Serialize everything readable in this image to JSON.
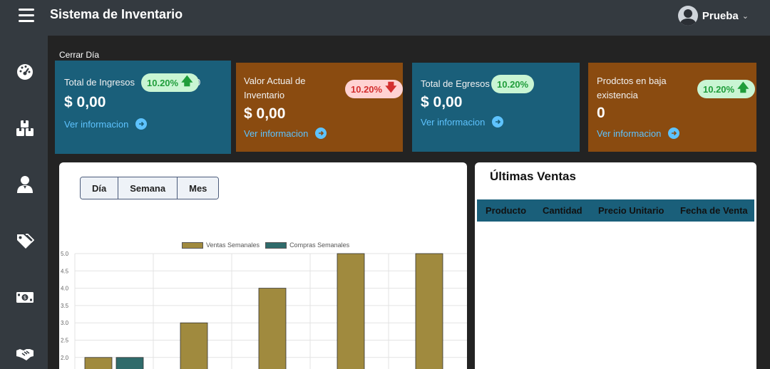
{
  "header": {
    "title": "Sistema de Inventario",
    "user_name": "Prueba",
    "user_chevron": "⌵"
  },
  "main": {
    "cerrar_label": "Cerrar Día"
  },
  "cards": [
    {
      "title": "Total de Ingresos",
      "title_suffix": "0",
      "value": "$ 0,00",
      "link": "Ver informacion",
      "badge": "10.20%",
      "trend": "up",
      "color": "#1a5f7a"
    },
    {
      "title": "Valor Actual de Inventario",
      "value": "$ 0,00",
      "link": "Ver informacion",
      "badge": "10.20%",
      "trend": "down",
      "color": "#8a4b10"
    },
    {
      "title": "Total de Egresos",
      "value": "$ 0,00",
      "link": "Ver informacion",
      "badge": "10.20%",
      "trend": "up",
      "color": "#1a5f7a"
    },
    {
      "title": "Prodctos en baja existencia",
      "value": "0",
      "link": "Ver informacion",
      "badge": "10.20%",
      "trend": "up",
      "color": "#8a4b10"
    }
  ],
  "chart_panel": {
    "buttons": [
      "Día",
      "Semana",
      "Mes"
    ]
  },
  "chart_data": {
    "type": "bar",
    "series": [
      {
        "name": "Ventas Semanales",
        "color": "#a08a3e",
        "values": [
          2,
          3,
          4,
          5,
          5
        ]
      },
      {
        "name": "Compras Semanales",
        "color": "#2f6b6b",
        "values": [
          2,
          null,
          null,
          null,
          null
        ]
      }
    ],
    "y_ticks": [
      "5.0",
      "4.5",
      "4.0",
      "3.5",
      "3.0",
      "2.5",
      "2.0"
    ],
    "ylim": [
      2.0,
      5.0
    ],
    "legend": "top-center",
    "grid": true
  },
  "ventas": {
    "title": "Últimas Ventas",
    "columns": [
      "Producto",
      "Cantidad",
      "Precio Unitario",
      "Fecha de Venta"
    ]
  },
  "sidebar": {
    "items": [
      {
        "icon": "dashboard-icon"
      },
      {
        "icon": "boxes-icon"
      },
      {
        "icon": "user-icon"
      },
      {
        "icon": "tags-icon"
      },
      {
        "icon": "money-icon"
      },
      {
        "icon": "handshake-icon"
      }
    ]
  }
}
